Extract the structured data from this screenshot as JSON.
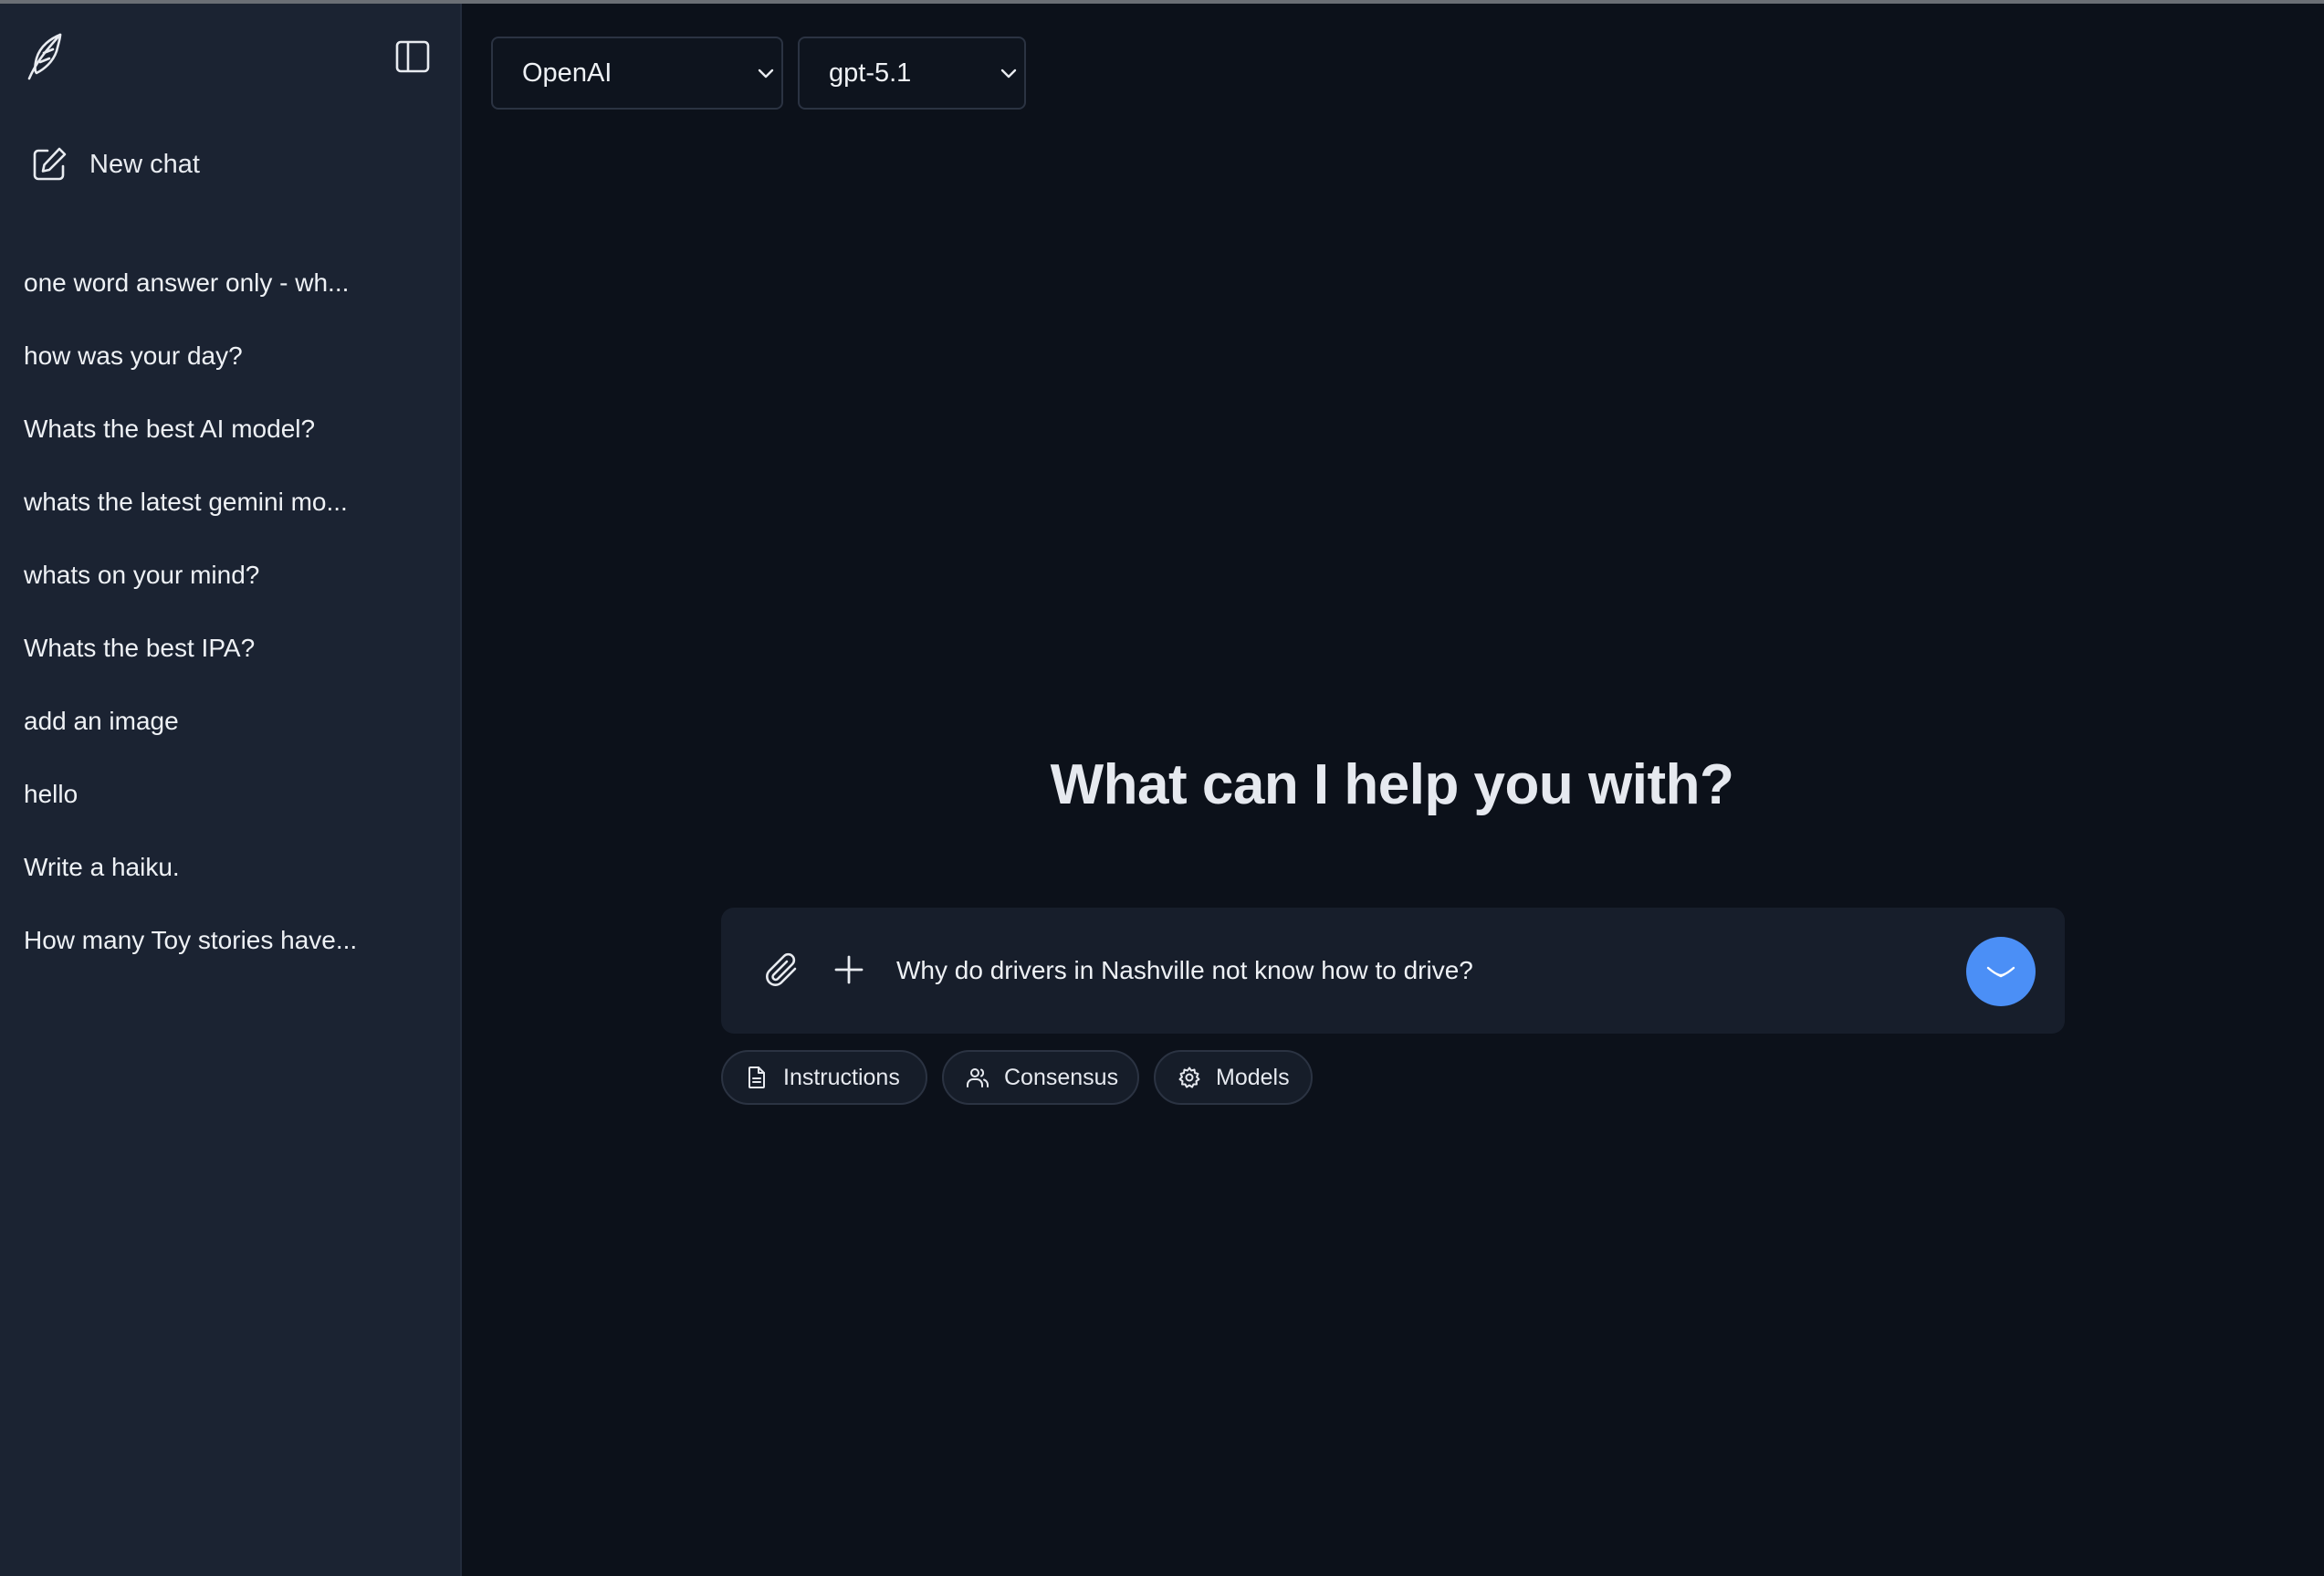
{
  "sidebar": {
    "logo_icon": "feather-icon",
    "toggle_icon": "sidebar-toggle-icon",
    "new_chat_label": "New chat",
    "history": [
      "one word answer only - wh...",
      "how was your day?",
      "Whats the best AI model?",
      "whats the latest gemini mo...",
      "whats on your mind?",
      "Whats the best IPA?",
      "add an image",
      "hello",
      "Write a haiku.",
      "How many Toy stories have..."
    ]
  },
  "toolbar": {
    "provider": "OpenAI",
    "model": "gpt-5.1"
  },
  "main": {
    "heading": "What can I help you with?",
    "input_value": "Why do drivers in Nashville not know how to drive?",
    "chips": {
      "instructions": "Instructions",
      "consensus": "Consensus",
      "models": "Models"
    }
  },
  "colors": {
    "accent": "#4b8ff6",
    "sidebar_bg": "#1b2332",
    "main_bg": "#0c111a"
  }
}
